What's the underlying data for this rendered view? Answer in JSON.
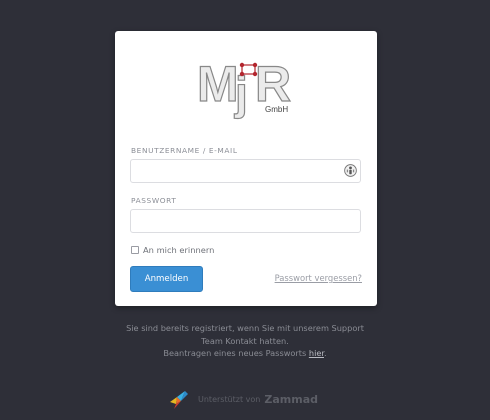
{
  "logo": {
    "name": "MjR GmbH",
    "main_text": "MjR",
    "sub_text": "GmbH"
  },
  "login": {
    "username_label": "BENUTZERNAME / E-MAIL",
    "username_value": "",
    "password_label": "PASSWORT",
    "password_value": "",
    "remember_label": "An mich erinnern",
    "submit_label": "Anmelden",
    "forgot_label": "Passwort vergessen?"
  },
  "info": {
    "line1": "Sie sind bereits registriert, wenn Sie mit unserem Support",
    "line2": "Team Kontakt hatten.",
    "line3_prefix": "Beantragen eines neues Passworts ",
    "line3_link": "hier",
    "line3_suffix": "."
  },
  "footer": {
    "powered_by": "Unterstützt von",
    "brand": "Zammad"
  },
  "colors": {
    "background": "#2e2f38",
    "accent": "#3a8fd4",
    "logo_red": "#b3262e"
  }
}
